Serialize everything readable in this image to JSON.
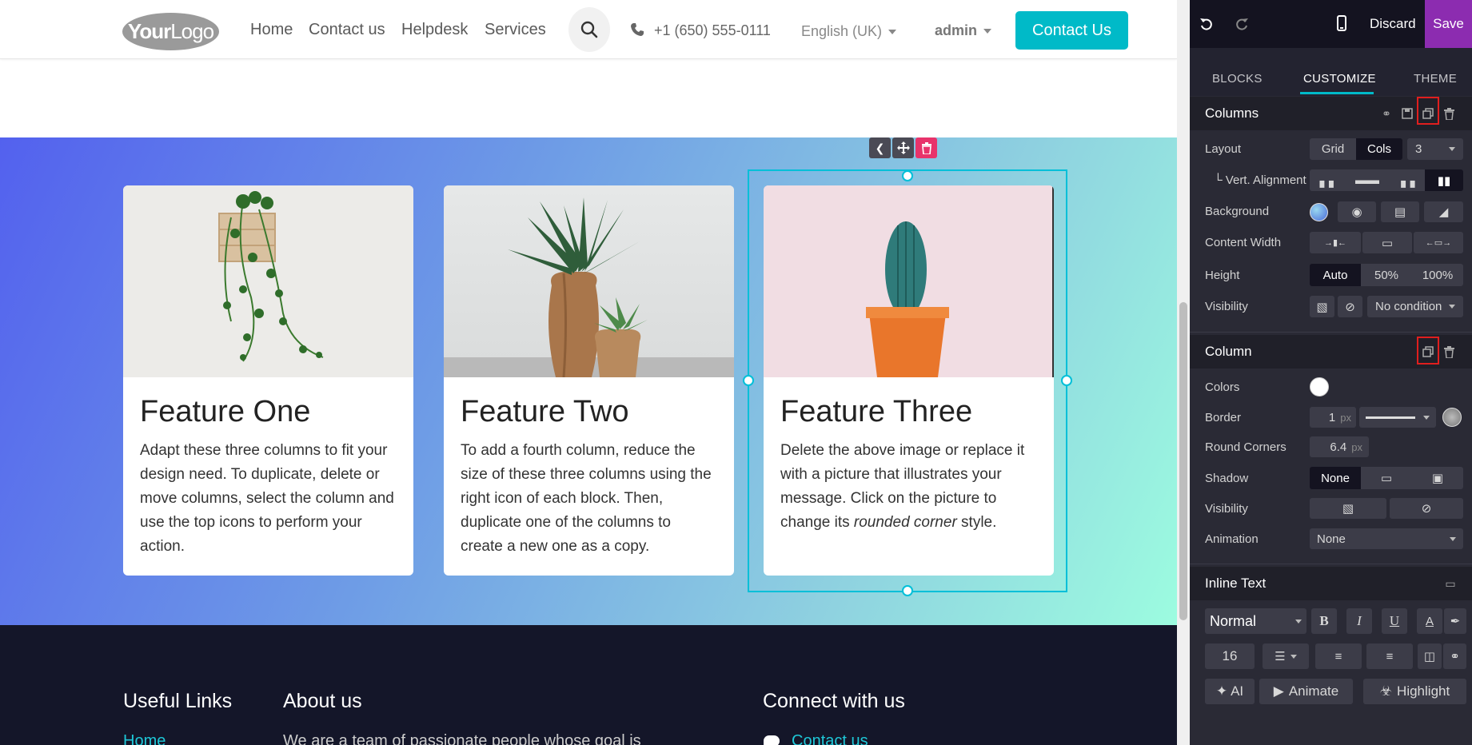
{
  "header": {
    "logo_text_bold": "Your",
    "logo_text_rest": "Logo",
    "nav": [
      "Home",
      "Contact us",
      "Helpdesk",
      "Services"
    ],
    "phone": "+1 (650) 555-0111",
    "language": "English (UK)",
    "user": "admin",
    "cta": "Contact Us"
  },
  "features": [
    {
      "title": "Feature One",
      "text": "Adapt these three columns to fit your design need. To duplicate, delete or move columns, select the column and use the top icons to perform your action."
    },
    {
      "title": "Feature Two",
      "text": "To add a fourth column, reduce the size of these three columns using the right icon of each block. Then, duplicate one of the columns to create a new one as a copy."
    },
    {
      "title": "Feature Three",
      "text_before": "Delete the above image or replace it with a picture that illustrates your message. Click on the picture to change its ",
      "text_em": "rounded corner",
      "text_after": " style."
    }
  ],
  "footer": {
    "useful_links": "Useful Links",
    "home_link": "Home",
    "about": "About us",
    "about_text": "We are a team of passionate people whose goal is",
    "connect": "Connect with us",
    "contact_link": "Contact us"
  },
  "editor": {
    "discard": "Discard",
    "save": "Save",
    "tabs": [
      "BLOCKS",
      "CUSTOMIZE",
      "THEME"
    ],
    "active_tab": "CUSTOMIZE",
    "columns_section": {
      "title": "Columns",
      "layout_label": "Layout",
      "layout_options": [
        "Grid",
        "Cols"
      ],
      "layout_selected": "Cols",
      "cols_value": "3",
      "vert_alignment_label": "└ Vert. Alignment",
      "background_label": "Background",
      "content_width_label": "Content Width",
      "height_label": "Height",
      "height_options": [
        "Auto",
        "50%",
        "100%"
      ],
      "height_selected": "Auto",
      "visibility_label": "Visibility",
      "visibility_value": "No condition"
    },
    "column_section": {
      "title": "Column",
      "colors_label": "Colors",
      "border_label": "Border",
      "border_value": "1",
      "border_unit": "px",
      "round_corners_label": "Round Corners",
      "round_corners_value": "6.4",
      "round_corners_unit": "px",
      "shadow_label": "Shadow",
      "shadow_value": "None",
      "visibility_label": "Visibility",
      "animation_label": "Animation",
      "animation_value": "None"
    },
    "inline_text_section": {
      "title": "Inline Text",
      "style_value": "Normal",
      "font_size": "16",
      "ai_button": "AI",
      "animate_button": "Animate",
      "highlight_button": "Highlight"
    }
  },
  "colors": {
    "brand": "#00bac8",
    "save_purple": "#8c2cb0",
    "highlight_red": "#e01e1e",
    "footer_bg": "#141629",
    "delete_pink": "#e8336b"
  }
}
